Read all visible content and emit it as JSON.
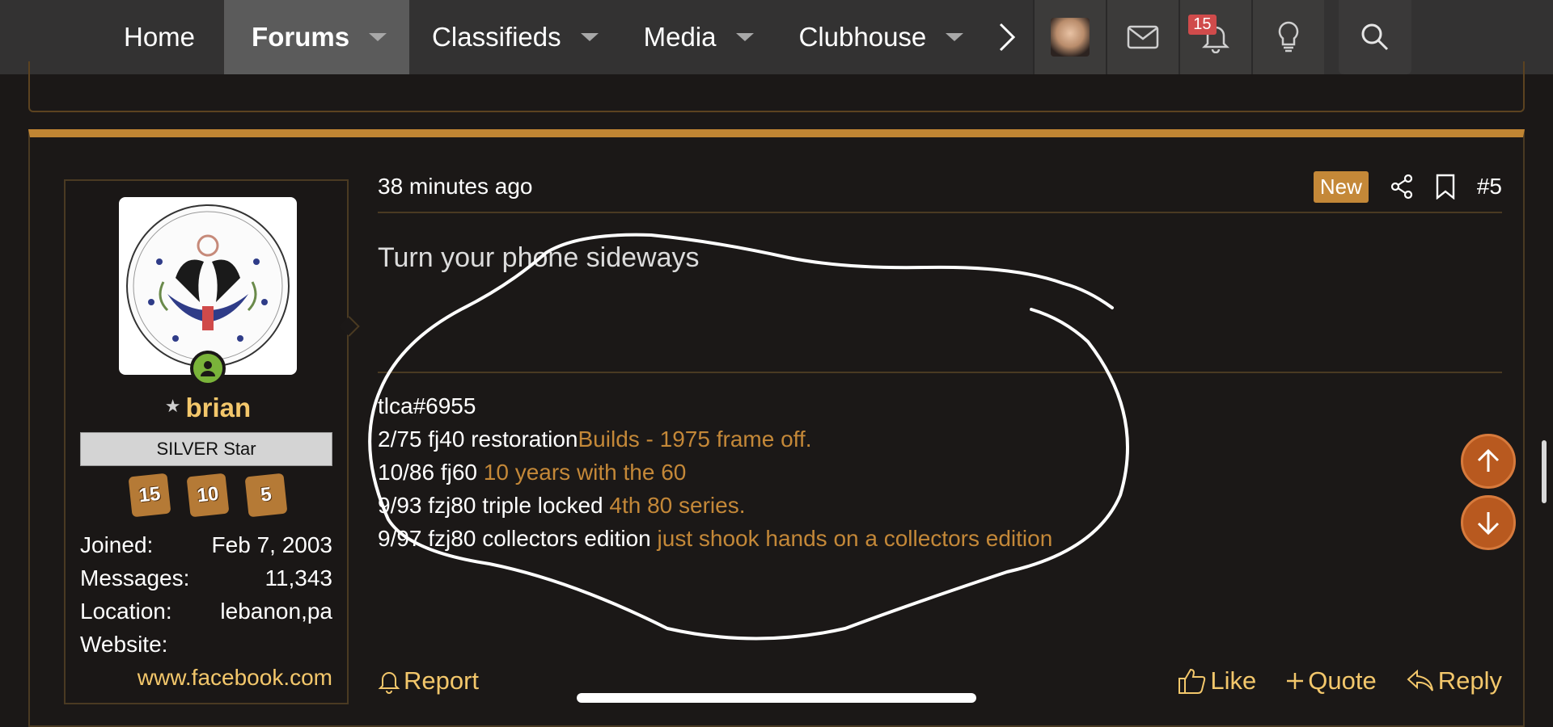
{
  "nav": {
    "tabs": [
      {
        "label": "Home"
      },
      {
        "label": "Forums"
      },
      {
        "label": "Classifieds"
      },
      {
        "label": "Media"
      },
      {
        "label": "Clubhouse"
      }
    ],
    "notification_count": "15"
  },
  "post": {
    "time": "38 minutes ago",
    "new_badge": "New",
    "post_number": "#5",
    "body": "Turn your phone sideways",
    "user": {
      "name": "brian",
      "title": "SILVER Star",
      "trophies": [
        "15",
        "10",
        "5"
      ],
      "stats": [
        {
          "label": "Joined:",
          "value": "Feb 7, 2003"
        },
        {
          "label": "Messages:",
          "value": "11,343"
        },
        {
          "label": "Location:",
          "value": "lebanon,pa"
        }
      ],
      "website_label": "Website:",
      "website_value": "www.facebook.com"
    },
    "signature": [
      {
        "text": "tlca#6955",
        "link": ""
      },
      {
        "text": "2/75 fj40 restoration",
        "link": "Builds - 1975 frame off."
      },
      {
        "text": "10/86 fj60 ",
        "link": "10 years with the 60"
      },
      {
        "text": "9/93 fzj80 triple locked ",
        "link": "4th 80 series."
      },
      {
        "text": "9/97 fzj80 collectors edition ",
        "link": "just shook hands on a collectors edition"
      }
    ],
    "actions": {
      "report": "Report",
      "like": "Like",
      "quote": "Quote",
      "reply": "Reply"
    }
  },
  "colors": {
    "accent": "#c48838",
    "username": "#f3c76b",
    "nav_bg": "#333232",
    "page_bg": "#1b1817",
    "scroll_button": "#b8591f"
  },
  "icons": [
    "chevron-right-icon",
    "user-avatar",
    "mail-icon",
    "bell-icon",
    "lightbulb-icon",
    "search-icon",
    "share-icon",
    "bookmark-icon",
    "bell-icon",
    "thumbs-up-icon",
    "plus-icon",
    "reply-icon",
    "arrow-up-icon",
    "arrow-down-icon"
  ]
}
